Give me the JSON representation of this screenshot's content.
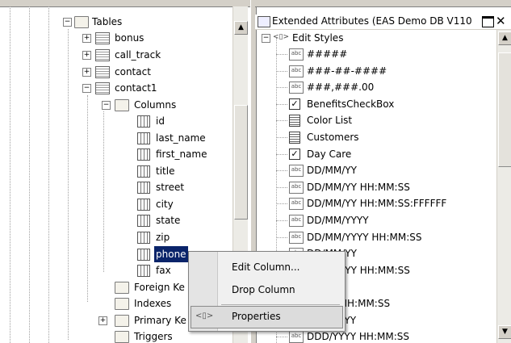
{
  "left_tree": {
    "tables": "Tables",
    "tables_list": [
      "bonus",
      "call_track",
      "contact",
      "contact1"
    ],
    "columns": "Columns",
    "column_list": [
      "id",
      "last_name",
      "first_name",
      "title",
      "street",
      "city",
      "state",
      "zip",
      "phone",
      "fax"
    ],
    "subfolders": [
      "Foreign Ke",
      "Indexes",
      "Primary Ke",
      "Triggers"
    ],
    "expand_plus": "+",
    "expand_minus": "−"
  },
  "right_pane": {
    "title": "Extended Attributes (EAS Demo DB V110",
    "root": "Edit Styles",
    "items": [
      {
        "label": "#####",
        "icon": "edit-mask-icon"
      },
      {
        "label": "###-##-####",
        "icon": "edit-mask-icon"
      },
      {
        "label": "###,###.00",
        "icon": "edit-mask-icon"
      },
      {
        "label": "BenefitsCheckBox",
        "icon": "checkbox-icon"
      },
      {
        "label": "Color List",
        "icon": "dropdown-icon"
      },
      {
        "label": "Customers",
        "icon": "listbox-icon"
      },
      {
        "label": "Day Care",
        "icon": "checkbox-icon"
      },
      {
        "label": "DD/MM/YY",
        "icon": "edit-mask-icon"
      },
      {
        "label": "DD/MM/YY HH:MM:SS",
        "icon": "edit-mask-icon"
      },
      {
        "label": "DD/MM/YY HH:MM:SS:FFFFFF",
        "icon": "edit-mask-icon"
      },
      {
        "label": "DD/MM/YYYY",
        "icon": "edit-mask-icon"
      },
      {
        "label": "DD/MM/YYYY HH:MM:SS",
        "icon": "edit-mask-icon"
      },
      {
        "label": "DD/MM/YY",
        "icon": "edit-mask-icon"
      },
      {
        "label": "DD/MM/YY HH:MM:SS",
        "icon": "edit-mask-icon"
      },
      {
        "label": "DD/YY",
        "icon": "edit-mask-icon"
      },
      {
        "label": "DD/YY HH:MM:SS",
        "icon": "edit-mask-icon"
      },
      {
        "label": "DDD/YYYY",
        "icon": "edit-mask-icon"
      },
      {
        "label": "DDD/YYYY HH:MM:SS",
        "icon": "edit-mask-icon"
      }
    ]
  },
  "context_menu": {
    "items": [
      "Edit Column...",
      "Drop Column",
      "Properties"
    ]
  }
}
